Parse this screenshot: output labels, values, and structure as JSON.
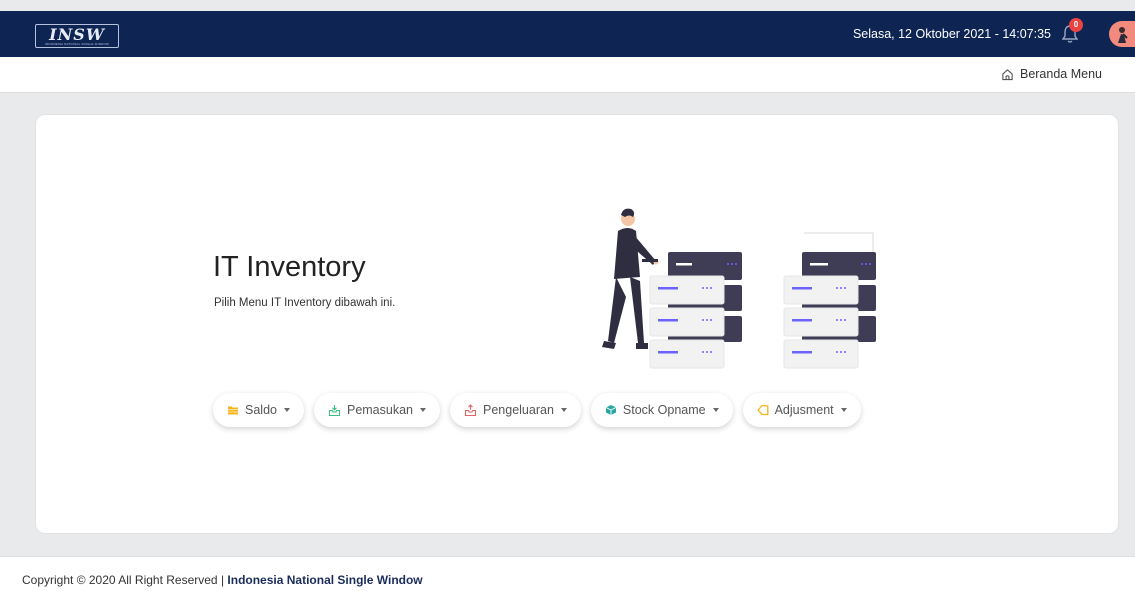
{
  "header": {
    "logo_text": "INSW",
    "logo_subtext": "INDONESIA NATIONAL SINGLE WINDOW",
    "datetime": "Selasa, 12 Oktober 2021 - 14:07:35",
    "notification_count": "0",
    "background_color": "#0e2452"
  },
  "subheader": {
    "home_label": "Beranda Menu"
  },
  "main": {
    "title": "IT Inventory",
    "subtitle": "Pilih Menu IT Inventory dibawah ini.",
    "buttons": [
      {
        "label": "Saldo",
        "icon": "folder-icon",
        "color": "#f3b51b"
      },
      {
        "label": "Pemasukan",
        "icon": "inbox-in-icon",
        "color": "#3cbf7f"
      },
      {
        "label": "Pengeluaran",
        "icon": "inbox-out-icon",
        "color": "#e26565"
      },
      {
        "label": "Stock Opname",
        "icon": "cube-icon",
        "color": "#2aa7a0"
      },
      {
        "label": "Adjusment",
        "icon": "tag-icon",
        "color": "#f3b51b"
      }
    ]
  },
  "footer": {
    "copyright": "Copyright © 2020 All Right Reserved | ",
    "org": "Indonesia National Single Window"
  }
}
